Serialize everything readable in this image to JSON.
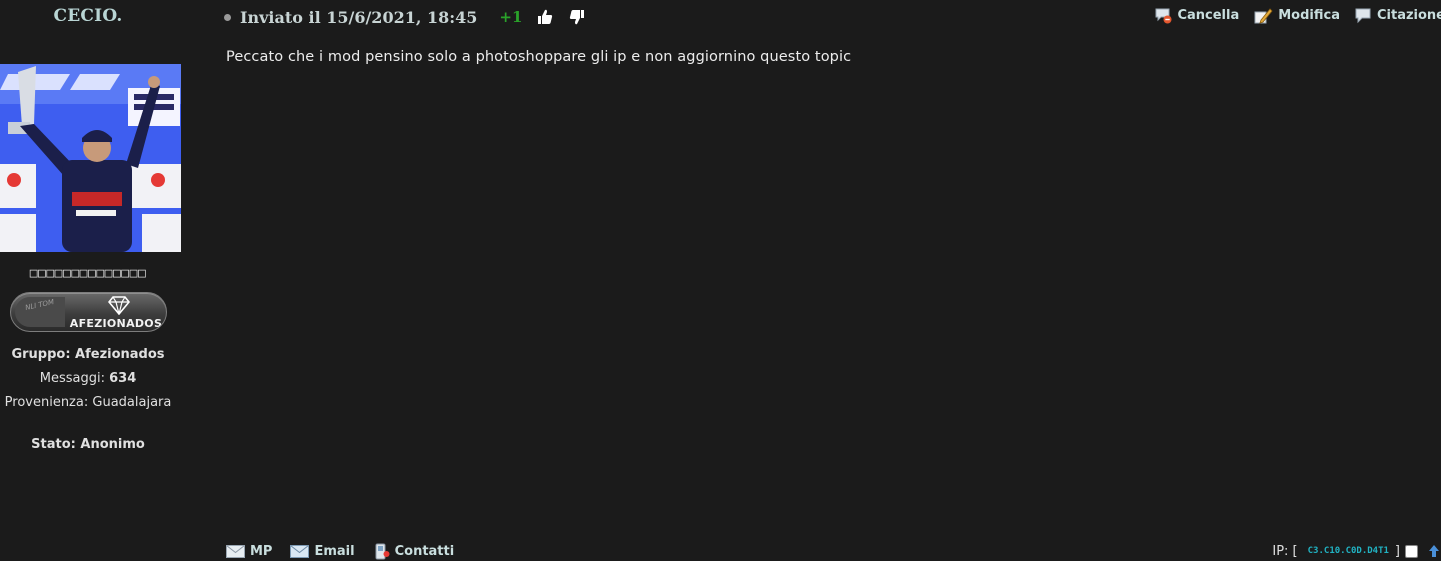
{
  "user": {
    "name": "CECIO.",
    "title": "□□□□□□□□□□□□□□",
    "badge": {
      "left_text": "NLI TOM",
      "label": "AFEZIONADOS"
    },
    "group_label": "Gruppo:",
    "group_value": "Afezionados",
    "messages_label": "Messaggi:",
    "messages_value": "634",
    "from_label": "Provenienza:",
    "from_value": "Guadalajara",
    "state_label": "Stato:",
    "state_value": "Anonimo"
  },
  "header": {
    "posted": "Inviato il 15/6/2021, 18:45",
    "reputation": "+1",
    "thumb_up_icon": "thumbs-up-icon",
    "thumb_down_icon": "thumbs-down-icon"
  },
  "actions": {
    "delete": "Cancella",
    "edit": "Modifica",
    "quote": "Citazione"
  },
  "body": {
    "text": "Peccato che i mod pensino solo a photoshoppare gli ip e non aggiornino questo topic"
  },
  "footer": {
    "pm": "MP",
    "email": "Email",
    "contacts": "Contatti",
    "ip_label": "IP: [",
    "ip_value": "C3.C10.C0D.D4T1",
    "ip_close": "]"
  },
  "colors": {
    "background": "#1b1b1b",
    "link": "#c9dede",
    "reputation": "#2aa22a",
    "ip": "#21b3c3",
    "avatar_bg": "#3e5ef0"
  }
}
